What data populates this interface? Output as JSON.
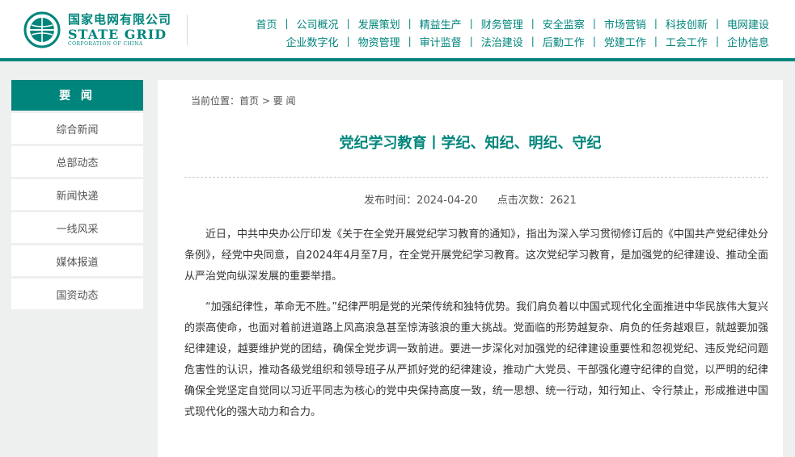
{
  "header": {
    "logo": {
      "cn": "国家电网有限公司",
      "en": "STATE GRID",
      "sub": "CORPORATION OF CHINA"
    },
    "nav_row1": [
      "首页",
      "公司概况",
      "发展策划",
      "精益生产",
      "财务管理",
      "安全监察",
      "市场营销",
      "科技创新",
      "电网建设"
    ],
    "nav_row2": [
      "企业数字化",
      "物资管理",
      "审计监督",
      "法治建设",
      "后勤工作",
      "党建工作",
      "工会工作",
      "企协信息"
    ]
  },
  "sidebar": {
    "title": "要 闻",
    "items": [
      "综合新闻",
      "总部动态",
      "新闻快递",
      "一线风采",
      "媒体报道",
      "国资动态"
    ]
  },
  "breadcrumb": {
    "label": "当前位置：",
    "home": "首页",
    "sep": " > ",
    "current": "要 闻"
  },
  "article": {
    "title": "党纪学习教育丨学纪、知纪、明纪、守纪",
    "publish": "发布时间：2024-04-20",
    "clicks": "点击次数：2621",
    "paragraphs": [
      "近日，中共中央办公厅印发《关于在全党开展党纪学习教育的通知》，指出为深入学习贯彻修订后的《中国共产党纪律处分条例》，经党中央同意，自2024年4月至7月，在全党开展党纪学习教育。这次党纪学习教育，是加强党的纪律建设、推动全面从严治党向纵深发展的重要举措。",
      "“加强纪律性，革命无不胜。”纪律严明是党的光荣传统和独特优势。我们肩负着以中国式现代化全面推进中华民族伟大复兴的崇高使命，也面对着前进道路上风高浪急甚至惊涛骇浪的重大挑战。党面临的形势越复杂、肩负的任务越艰巨，就越要加强纪律建设，越要维护党的团结，确保全党步调一致前进。要进一步深化对加强党的纪律建设重要性和忽视党纪、违反党纪问题危害性的认识，推动各级党组织和领导班子从严抓好党的纪律建设，推动广大党员、干部强化遵守纪律的自觉，以严明的纪律确保全党坚定自觉同以习近平同志为核心的党中央保持高度一致，统一思想、统一行动，知行知止、令行禁止，形成推进中国式现代化的强大动力和合力。"
    ]
  },
  "colors": {
    "brand": "#00857c",
    "background": "#eef0ef"
  }
}
